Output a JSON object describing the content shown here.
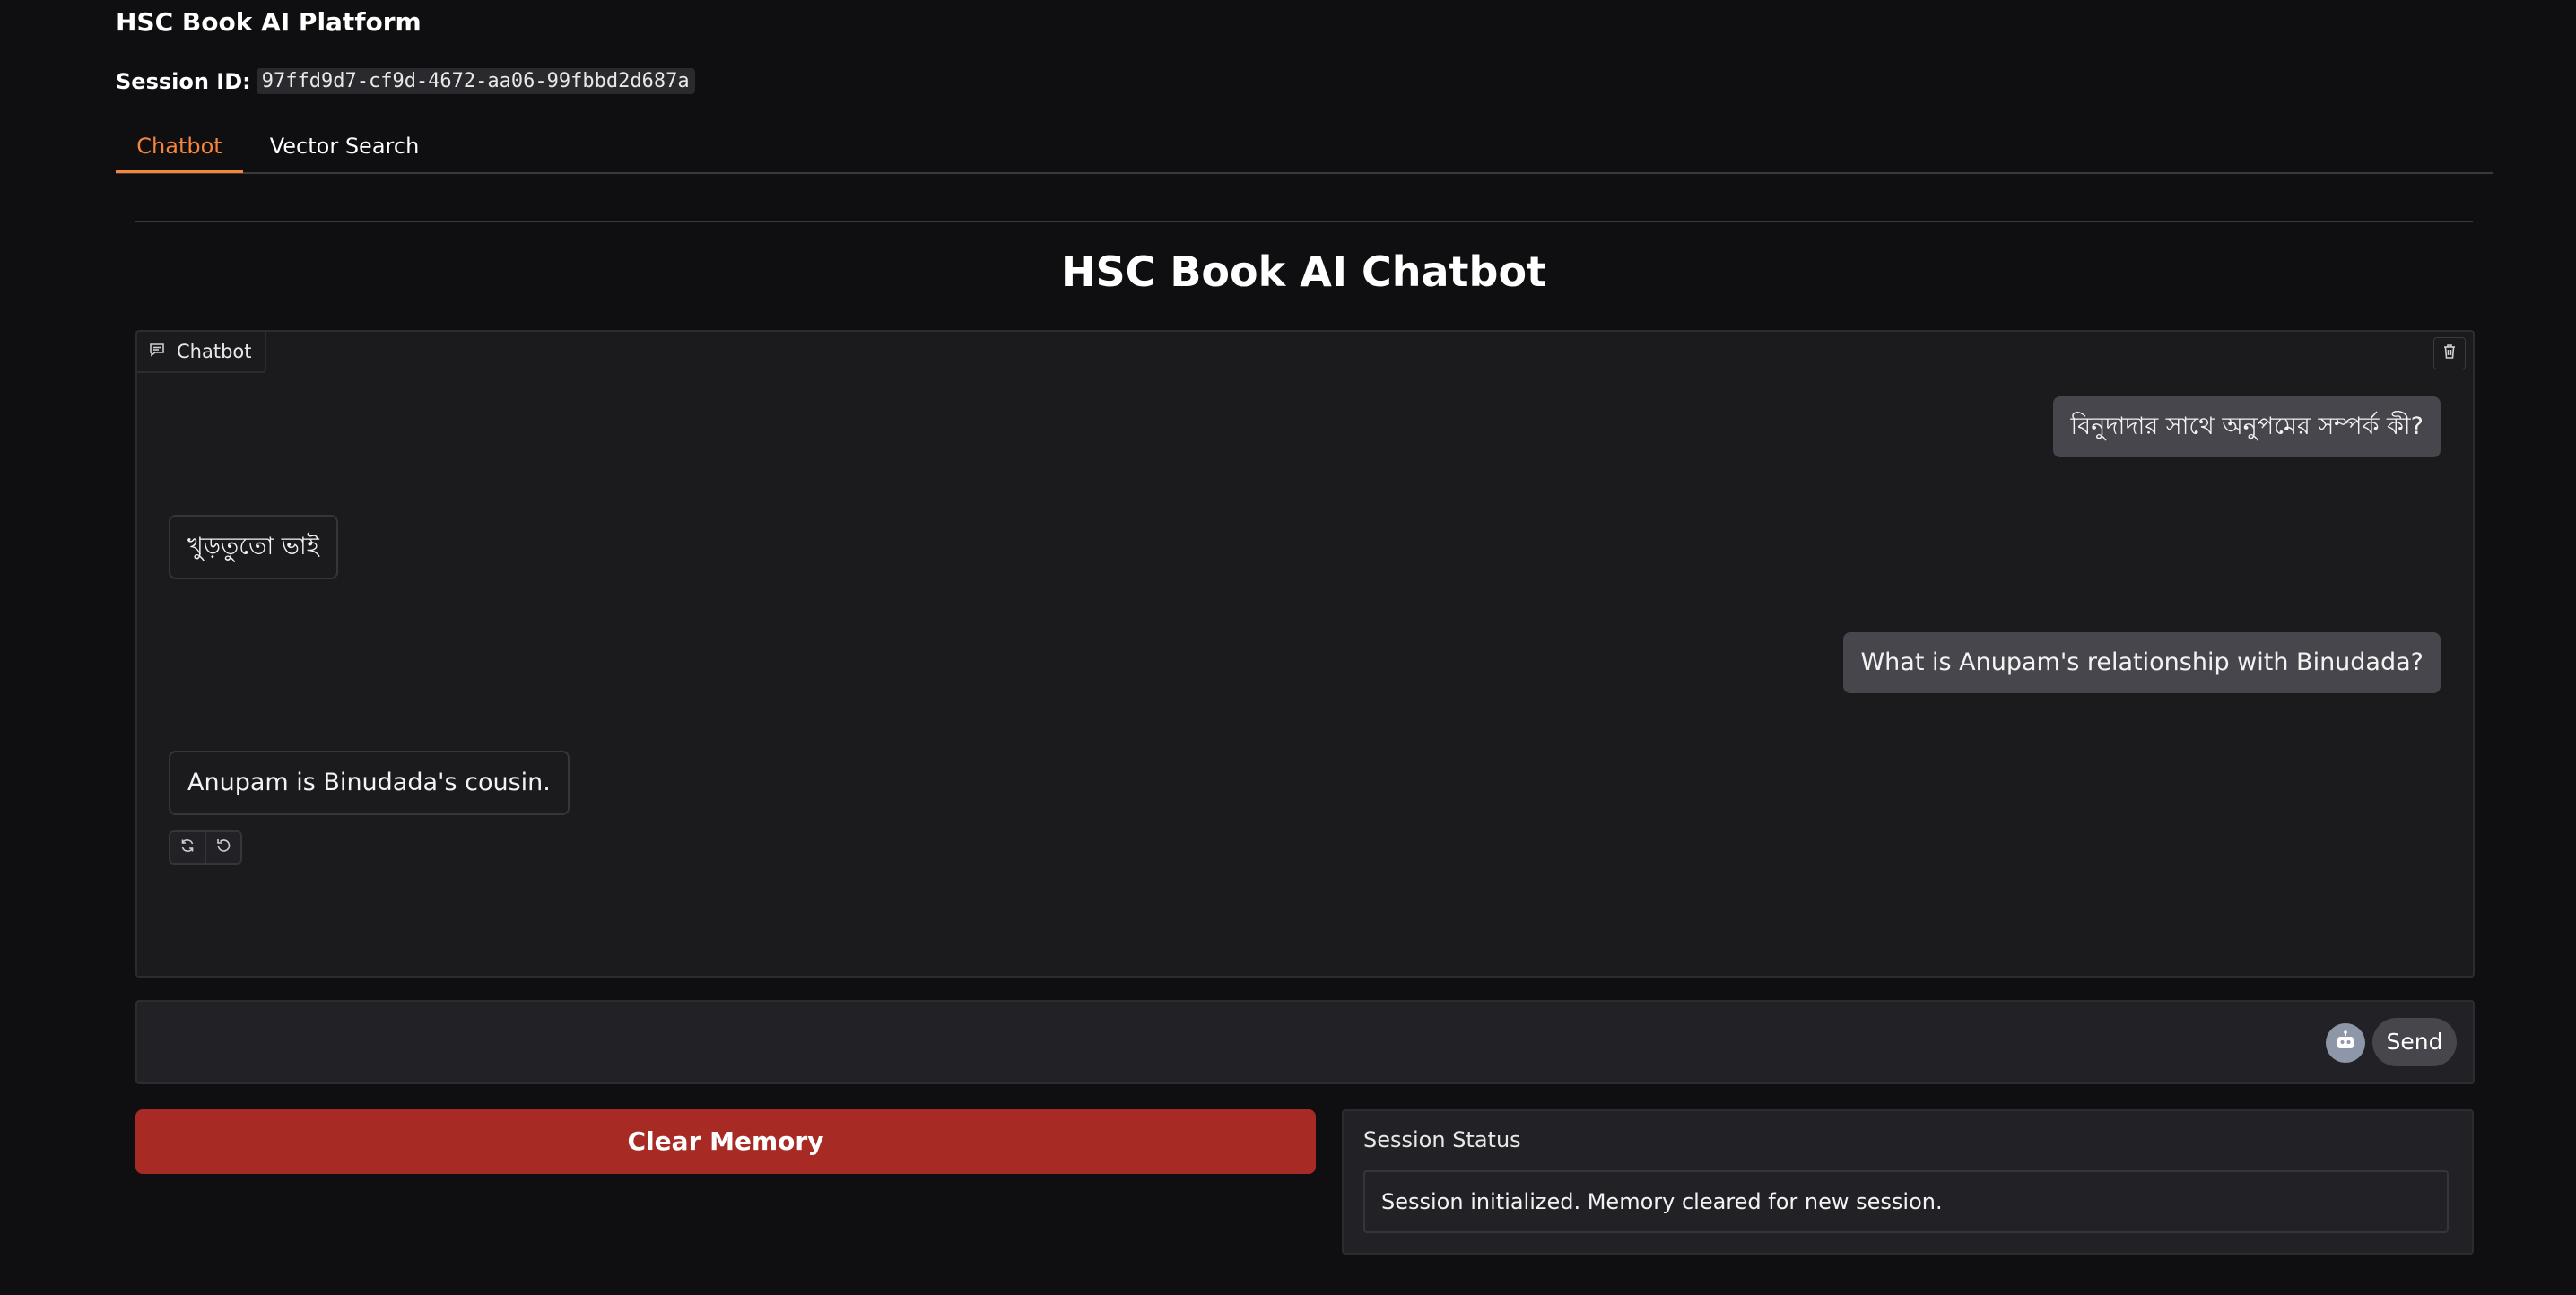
{
  "app": {
    "title": "HSC Book AI Platform",
    "session_label": "Session ID:",
    "session_id": "97ffd9d7-cf9d-4672-aa06-99fbbd2d687a"
  },
  "tabs": [
    {
      "label": "Chatbot",
      "active": true
    },
    {
      "label": "Vector Search",
      "active": false
    }
  ],
  "main": {
    "heading": "HSC Book AI Chatbot"
  },
  "chatbot": {
    "label": "Chatbot",
    "messages": [
      {
        "role": "user",
        "text": "বিনুদাদার সাথে অনুপমের সম্পর্ক কী?"
      },
      {
        "role": "bot",
        "text": "খুড়তুতো ভাই"
      },
      {
        "role": "user",
        "text": "What is Anupam's relationship with Binudada?"
      },
      {
        "role": "bot",
        "text": "Anupam is Binudada's cousin."
      }
    ]
  },
  "input": {
    "placeholder": "",
    "value": "",
    "send_label": "Send"
  },
  "actions": {
    "clear_label": "Clear Memory"
  },
  "status": {
    "label": "Session Status",
    "text": "Session initialized. Memory cleared for new session."
  },
  "colors": {
    "background": "#0f0f11",
    "accent": "#f5853a",
    "danger": "#a82a24",
    "user_bubble": "#46464c"
  }
}
